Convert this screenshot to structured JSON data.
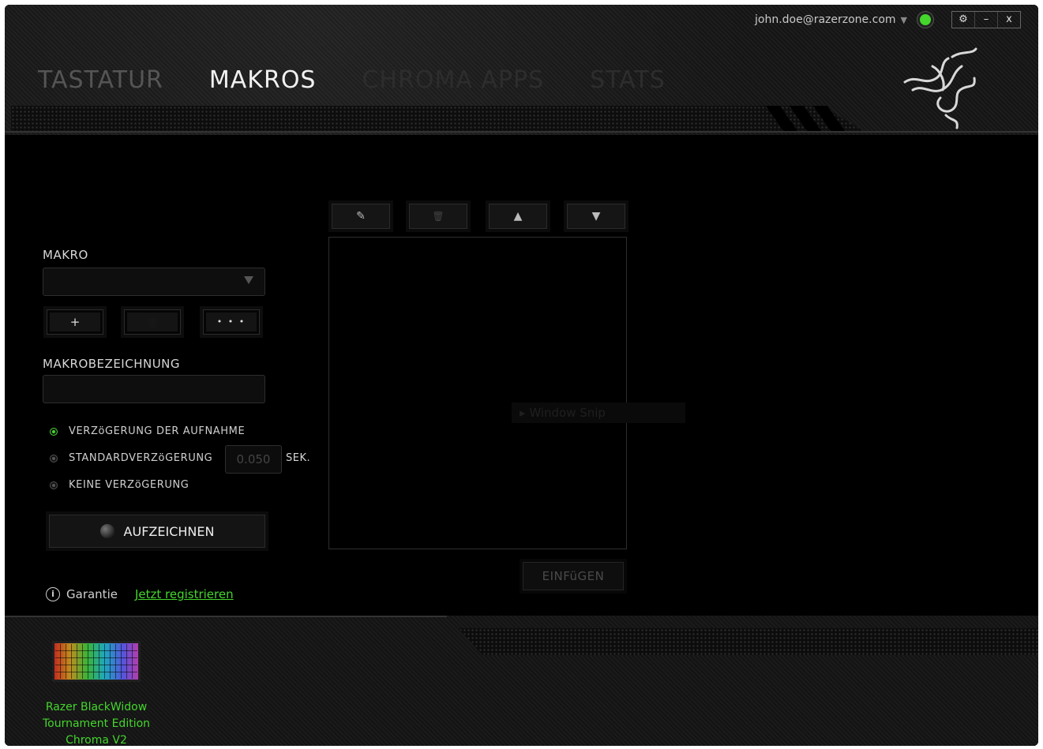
{
  "topbar": {
    "account": "john.doe@razerzone.com",
    "window_buttons": [
      "⚙",
      "–",
      "x"
    ]
  },
  "tabs": [
    {
      "label": "TASTATUR",
      "state": "inactive"
    },
    {
      "label": "MAKROS",
      "state": "active"
    },
    {
      "label": "CHROMA APPS",
      "state": "disabled"
    },
    {
      "label": "STATS",
      "state": "disabled"
    }
  ],
  "macro": {
    "label": "MAKRO",
    "selected": "",
    "buttons": {
      "add": "+",
      "delete": "🗑",
      "more": "• • •"
    }
  },
  "macro_name": {
    "label": "MAKROBEZEICHNUNG",
    "value": ""
  },
  "delay_options": [
    {
      "label": "VERZöGERUNG DER AUFNAHME",
      "selected": true
    },
    {
      "label": "STANDARDVERZöGERUNG",
      "selected": false
    },
    {
      "label": "KEINE VERZöGERUNG",
      "selected": false
    }
  ],
  "default_delay": {
    "value": "0.050",
    "unit": "SEK."
  },
  "record_button": "AUFZEICHNEN",
  "editor_toolbar": {
    "edit": "✎",
    "delete": "🗑",
    "up": "▲",
    "down": "▼"
  },
  "ghost_item": "Window Snip",
  "insert_button": "EINFüGEN",
  "warranty": {
    "label": "Garantie",
    "link": "Jetzt registrieren"
  },
  "device": {
    "name_line1": "Razer BlackWidow",
    "name_line2": "Tournament Edition",
    "name_line3": "Chroma V2"
  },
  "colors": {
    "accent": "#44d62c",
    "background": "#000000"
  }
}
